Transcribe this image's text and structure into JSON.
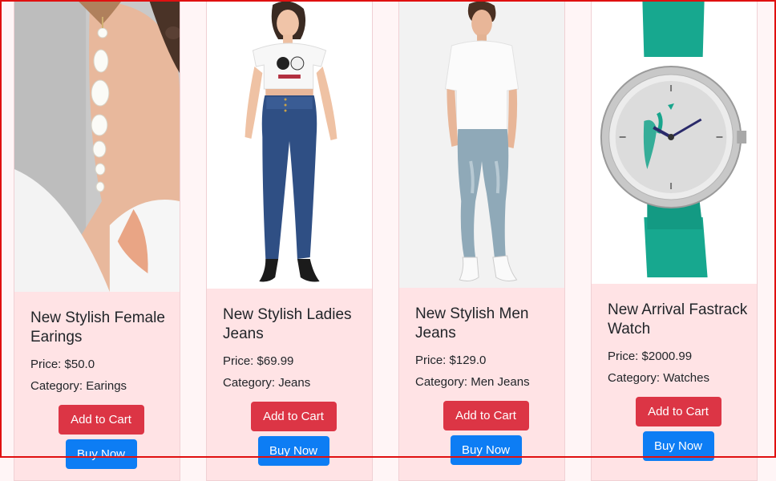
{
  "products": [
    {
      "title": "New Stylish Female Earings",
      "price": "Price: $50.0",
      "category": "Category: Earings",
      "image_icon": "earrings-photo"
    },
    {
      "title": "New Stylish Ladies Jeans",
      "price": "Price: $69.99",
      "category": "Category: Jeans",
      "image_icon": "ladies-jeans-photo"
    },
    {
      "title": "New Stylish Men Jeans",
      "price": "Price: $129.0",
      "category": "Category: Men Jeans",
      "image_icon": "men-jeans-photo"
    },
    {
      "title": "New Arrival Fastrack Watch",
      "price": "Price: $2000.99",
      "category": "Category: Watches",
      "image_icon": "watch-photo"
    }
  ],
  "buttons": {
    "add_to_cart": "Add to Cart",
    "buy_now": "Buy Now"
  },
  "colors": {
    "card_bg": "#ffe3e5",
    "add_to_cart": "#dc3545",
    "buy_now": "#0d7df4",
    "frame": "#e01010"
  }
}
